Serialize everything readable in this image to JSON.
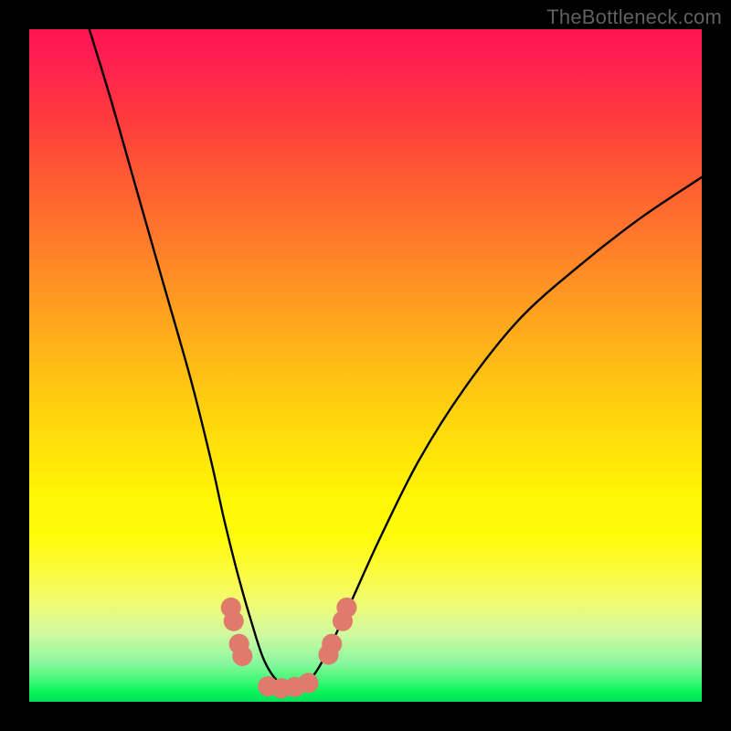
{
  "watermark": "TheBottleneck.com",
  "chart_data": {
    "type": "line",
    "title": "",
    "xlabel": "",
    "ylabel": "",
    "xlim": [
      0,
      100
    ],
    "ylim": [
      0,
      100
    ],
    "grid": false,
    "legend": false,
    "series": [
      {
        "name": "bottleneck-curve",
        "x": [
          8,
          12,
          16,
          20,
          24,
          27,
          29,
          31,
          33,
          35,
          37.5,
          40,
          43,
          47,
          52,
          58,
          65,
          73,
          82,
          91,
          100
        ],
        "y": [
          103,
          90,
          76,
          62,
          48,
          36,
          27,
          19,
          12,
          6,
          2.5,
          1.8,
          5,
          13,
          24,
          36,
          47,
          57,
          65,
          72,
          78
        ]
      }
    ],
    "beads": {
      "name": "highlight-beads",
      "points": [
        {
          "x": 30.0,
          "y": 14.0
        },
        {
          "x": 30.4,
          "y": 12.0
        },
        {
          "x": 31.2,
          "y": 8.6
        },
        {
          "x": 31.7,
          "y": 6.8
        },
        {
          "x": 35.5,
          "y": 2.3
        },
        {
          "x": 37.5,
          "y": 2.0
        },
        {
          "x": 39.5,
          "y": 2.2
        },
        {
          "x": 41.5,
          "y": 2.8
        },
        {
          "x": 44.5,
          "y": 7.0
        },
        {
          "x": 45.0,
          "y": 8.6
        },
        {
          "x": 46.6,
          "y": 12.0
        },
        {
          "x": 47.2,
          "y": 14.0
        }
      ],
      "radius": 1.5
    },
    "background_gradient": {
      "top_color": "#ff1452",
      "mid_color": "#fff705",
      "bottom_color": "#00e25a"
    }
  }
}
